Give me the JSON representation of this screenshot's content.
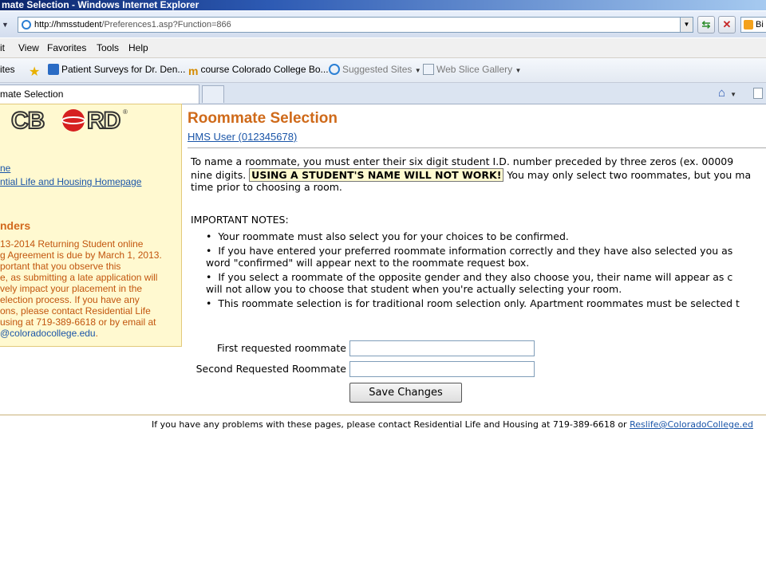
{
  "window": {
    "title": "mate Selection - Windows Internet Explorer"
  },
  "address": {
    "host": "http://hmsstudent",
    "rest": "/Preferences1.asp?Function=866"
  },
  "search": {
    "label": "Bi"
  },
  "menu": {
    "file": "it",
    "view": "View",
    "favorites": "Favorites",
    "tools": "Tools",
    "help": "Help"
  },
  "favorites_bar": {
    "label": "ites",
    "items": [
      "Patient Surveys for Dr. Den...",
      "course Colorado College Bo...",
      "Suggested Sites",
      "Web Slice Gallery"
    ]
  },
  "tab": {
    "title": "mate Selection"
  },
  "sidebar": {
    "logo": "CBORD",
    "links": [
      "ne",
      "ntial Life and Housing Homepage"
    ],
    "reminders_title": "nders",
    "reminder_lines": [
      "13-2014 Returning Student online",
      "g Agreement is due by March 1, 2013.",
      "portant that you observe this",
      "e, as submitting a late application will",
      "vely impact your placement in the",
      "election process. If you have any",
      "ons, please contact Residential Life",
      "using at 719-389-6618 or by email at"
    ],
    "email": "@coloradocollege.edu",
    "email_end": "."
  },
  "main": {
    "title": "Roommate Selection",
    "user": "HMS User (012345678)",
    "intro_line1": "To name a roommate, you must enter their six digit student I.D. number preceded by three zeros (ex. 00009",
    "intro_line2_start": "nine digits. ",
    "intro_warning": "USING A STUDENT'S NAME WILL NOT WORK!",
    "intro_line2_end": " You may only select two roommates, but you ma",
    "intro_line3": "time prior to choosing a room.",
    "notes_title": "IMPORTANT NOTES:",
    "notes": [
      "Your roommate must also select you for your choices to be confirmed.",
      "If you have entered your preferred roommate information correctly and they have also selected you as",
      "If you select a roommate of the opposite gender and they also choose you, their name will appear as c",
      "This roommate selection is for traditional room selection only. Apartment roommates must be selected t"
    ],
    "note2_cont": "word \"confirmed\" will appear next to the roommate request box.",
    "note3_cont": "will not allow you to choose that student when you're actually selecting your room.",
    "bullet": "•",
    "form": {
      "first_label": "First requested roommate",
      "first_value": "",
      "second_label": "Second Requested Roommate",
      "second_value": "",
      "save_label": "Save Changes"
    }
  },
  "footer": {
    "text": "If you have any problems with these pages, please contact Residential Life and Housing at 719-389-6618 or ",
    "email": "Reslife@ColoradoCollege.ed"
  },
  "colors": {
    "accent": "#cf6a1a",
    "link": "#1a55a8",
    "sidebar_bg": "#fff9d0"
  }
}
